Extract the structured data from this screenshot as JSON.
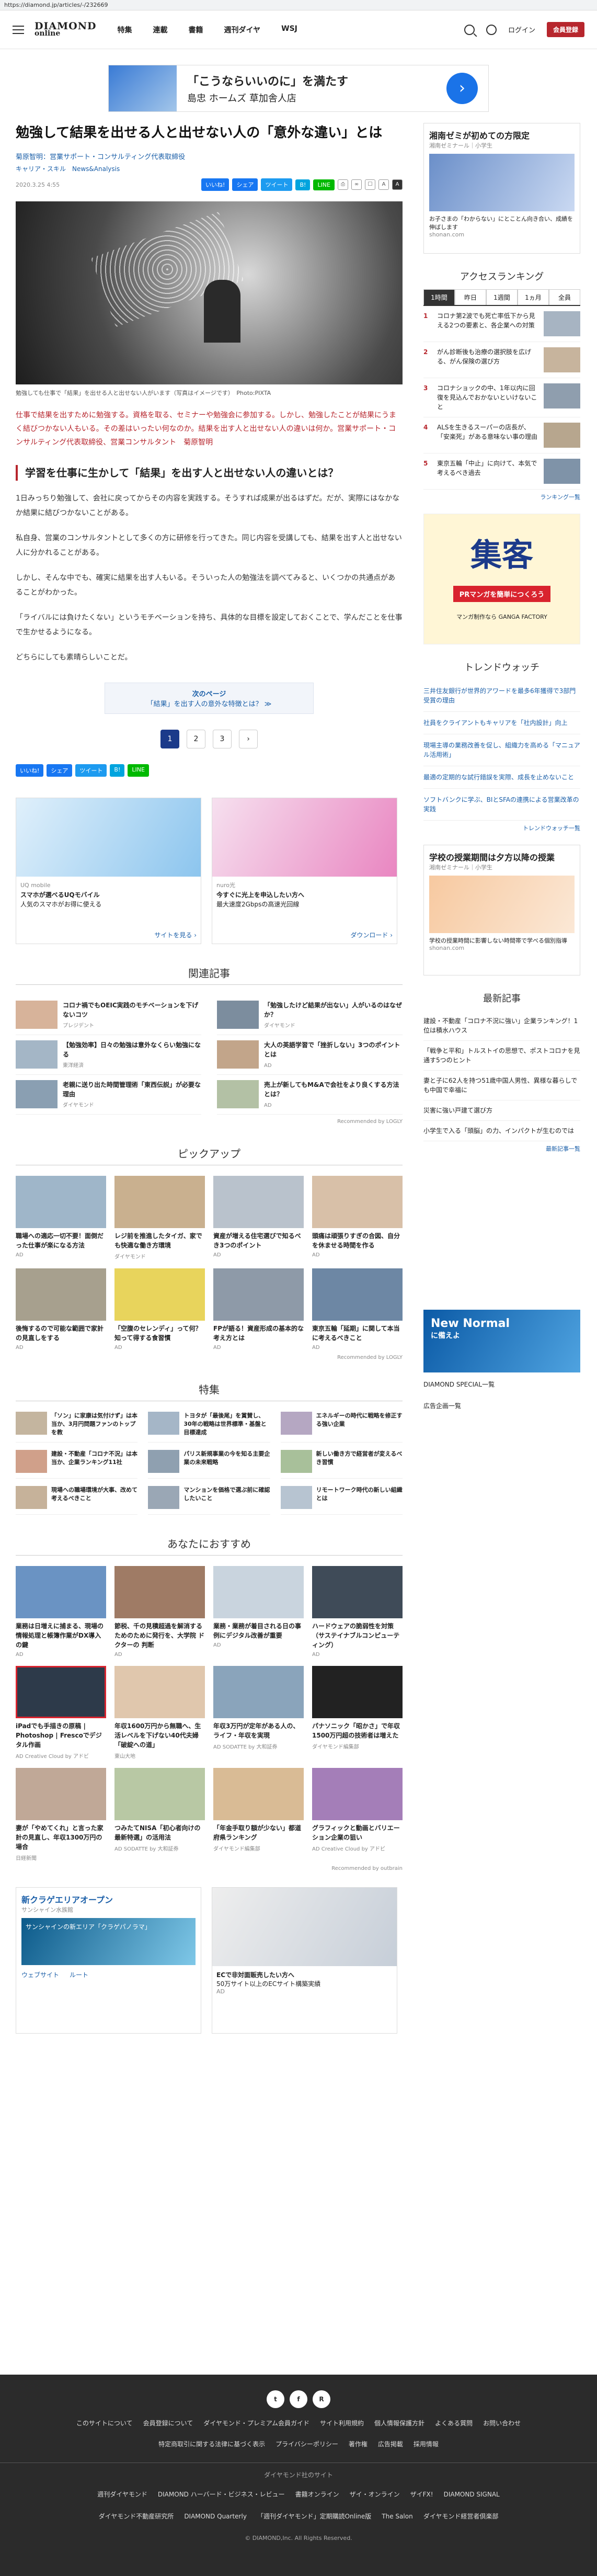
{
  "url": "https://diamond.jp/articles/-/232669",
  "header": {
    "logo_top": "DIAMOND",
    "logo_bottom": "online",
    "nav": [
      "特集",
      "連載",
      "書籍",
      "週刊ダイヤ",
      "WSJ"
    ],
    "login": "ログイン",
    "register": "会員登録"
  },
  "top_ad": {
    "line1": "「こうならいいのに」を満たす",
    "line2": "島忠 ホームズ 草加舎人店"
  },
  "article": {
    "title": "勉強して結果を出せる人と出せない人の「意外な違い」とは",
    "byline": "菊原智明：営業サポート・コンサルティング代表取締役",
    "tags": "キャリア・スキル　News&Analysis",
    "date": "2020.3.25 4:55",
    "caption": "勉強しても仕事で「結果」を出せる人と出せない人がいます（写真はイメージです）　Photo:PIXTA",
    "lead": "仕事で結果を出すために勉強する。資格を取る、セミナーや勉強会に参加する。しかし、勉強したことが結果にうまく結びつかない人もいる。その差はいったい何なのか。結果を出す人と出せない人の違いは何か。営業サポート・コンサルティング代表取締役、営業コンサルタント　菊原智明",
    "subheading": "学習を仕事に生かして「結果」を出す人と出せない人の違いとは？",
    "paras": [
      "1日みっちり勉強して、会社に戻ってからその内容を実践する。そうすれば成果が出るはずだ。だが、実際にはなかなか結果に結びつかないことがある。",
      "私自身、営業のコンサルタントとして多くの方に研修を行ってきた。同じ内容を受講しても、結果を出す人と出せない人に分かれることがある。",
      "しかし、そんな中でも、確実に結果を出す人もいる。そういった人の勉強法を調べてみると、いくつかの共通点があることがわかった。",
      "「ライバルには負けたくない」というモチベーションを持ち、具体的な目標を設定しておくことで、学んだことを仕事で生かせるようになる。",
      "どちらにしても素晴らしいことだ。"
    ],
    "next_label": "次のページ",
    "next_link": "「結果」を出す人の意外な特徴とは？ ≫",
    "pages": [
      "1",
      "2",
      "3",
      "›"
    ]
  },
  "share": {
    "like": "いいね!",
    "share": "シェア",
    "tweet": "ツイート",
    "hatena": "B!",
    "line": "LINE",
    "font_small": "A",
    "font_large": "A"
  },
  "ad_cards": [
    {
      "label": "UQ mobile",
      "title": "スマホが選べるUQモバイル",
      "desc": "人気のスマホがお得に使える",
      "cta": "サイトを見る ›"
    },
    {
      "label": "nuro光",
      "title": "今すぐに光上を申込したい方へ",
      "desc": "最大速度2Gbpsの高速光回線",
      "cta": "ダウンロード ›"
    }
  ],
  "related": {
    "title": "関連記事",
    "items": [
      {
        "title": "コロナ禍でもOEIC実践のモチベーションを下げないコツ",
        "source": "プレジデント"
      },
      {
        "title": "「勉強したけど結果が出ない」人がいるのはなぜか？",
        "source": "ダイヤモンド"
      },
      {
        "title": "【勉強効率】日々の勉強は意外なくらい勉強になる",
        "source": "東洋経済"
      },
      {
        "title": "大人の英語学習で「挫折しない」3つのポイントとは",
        "source": "AD"
      },
      {
        "title": "老親に送り出た時間管理術「東西伝説」が必要な理由",
        "source": "ダイヤモンド"
      },
      {
        "title": "売上が新してもM&Aで会社をより良くする方法とは？",
        "source": "AD"
      }
    ],
    "rec": "Recommended by LOGLY"
  },
  "pickup": {
    "title": "ピックアップ",
    "items": [
      {
        "title": "職場への適応一切不要！面倒だった仕事が楽になる方法",
        "src": "AD"
      },
      {
        "title": "レジ前を推進したタイガ、家でも快適な働き方環境",
        "src": "ダイヤモンド"
      },
      {
        "title": "資産が増える住宅選びで知るべき3つのポイント",
        "src": "AD"
      },
      {
        "title": "頭痛は頑張りすぎの合図、自分を休ませる時間を作る",
        "src": "AD"
      },
      {
        "title": "後悔するので可能な範囲で家計の見直しをする",
        "src": "AD"
      },
      {
        "title": "「空腹のセレンディ」って何？知って得する食習慣",
        "src": "AD"
      },
      {
        "title": "FPが語る！資産形成の基本的な考え方とは",
        "src": "AD"
      },
      {
        "title": "東京五輪「延期」に関して本当に考えるべきこと",
        "src": "AD"
      }
    ],
    "rec": "Recommended by LOGLY"
  },
  "features": {
    "title": "特集",
    "items": [
      {
        "title": "「ソン」に家康は気付けず」は本当か、3月円問題ファンのトップを教"
      },
      {
        "title": "トヨタが「最後尾」を賞賛し、30年の戦略は世界標準・基盤と目標達成"
      },
      {
        "title": "エネルギーの時代に戦略を修正する強い企業"
      },
      {
        "title": "建設・不動産「コロナ不況」は本当か、企業ランキング11社"
      },
      {
        "title": "パリス新規事業の今を知る主要企業の未来戦略"
      },
      {
        "title": "新しい働き方で経営者が変えるべき習慣"
      },
      {
        "title": "現場への職場環境が大事、改めて考えるべきこと"
      },
      {
        "title": "マンションを価格で選ぶ前に確認したいこと"
      },
      {
        "title": "リモートワーク時代の新しい組織とは"
      }
    ]
  },
  "osusume": {
    "title": "あなたにおすすめ",
    "items": [
      {
        "title": "業務は日増えに捕まる、現場の情報処理と帳簿作業がDX導入の鍵",
        "src": "AD"
      },
      {
        "title": "節税、千の見積超過を解消するためのために発行を、大学院 ドクターの 判断",
        "src": "AD"
      },
      {
        "title": "業務・業務が着目される日の事例にデジタル改善が重要",
        "src": "AD"
      },
      {
        "title": "ハードウェアの脆弱性を対策（サステイナブルコンピューティング）",
        "src": "AD"
      },
      {
        "title": "iPadでも手描きの原稿 | Photoshop | Frescoでデジタル作画",
        "src": "AD Creative Cloud by アドビ"
      },
      {
        "title": "年収1600万円から無職へ、生活レベルを下げない40代夫婦「破綻への道」",
        "src": "東山大地"
      },
      {
        "title": "年収3万円が定年がある人の、ライフ・年収を実現",
        "src": "AD SODATTE by 大和証券"
      },
      {
        "title": "パナソニック「昭かさ」で年収1500万円超の技術者は増えた",
        "src": "ダイヤモンド編集部"
      },
      {
        "title": "妻が「やめてくれ」と言った家計の見直し、年収1300万円の場合",
        "src": "日経新聞"
      },
      {
        "title": "つみたてNISA「初心者向けの最新特選」の活用法",
        "src": "AD SODATTE by 大和証券"
      },
      {
        "title": "「年金手取り額が少ない」都道府県ランキング",
        "src": "ダイヤモンド編集部"
      },
      {
        "title": "グラフィックと動画とバリエーション企業の狙い",
        "src": "AD Creative Cloud by アドビ"
      }
    ],
    "rec": "Recommended by outbrain"
  },
  "bottom_ads": [
    {
      "title": "新クラゲエリアオープン",
      "sub": "サンシャイン水族館",
      "desc": "サンシャインの新エリア「クラゲパノラマ」",
      "btn1": "ウェブサイト",
      "btn2": "ルート"
    },
    {
      "title": "ECで非対面販売したい方へ",
      "desc": "50万サイト以上のECサイト構築実績",
      "src": "AD"
    }
  ],
  "sidebar": {
    "ad1": {
      "title": "湘南ゼミが初めての方限定",
      "sub": "湘南ゼミナール｜小学生",
      "desc": "お子さまの「わからない」にとことん向き合い、成績を伸ばします",
      "src": "shonan.com"
    },
    "rank_title": "アクセスランキング",
    "rank_tabs": [
      "1時間",
      "昨日",
      "1週間",
      "1ヵ月",
      "全員"
    ],
    "rank": [
      {
        "n": "1",
        "t": "コロナ第2波でも死亡率低下から見える2つの要素と、各企業への対策"
      },
      {
        "n": "2",
        "t": "がん診断後も治療の選択肢を広げる、がん保険の選び方"
      },
      {
        "n": "3",
        "t": "コロナショックの中、1年以内に回復を見込んでおかないといけないこと"
      },
      {
        "n": "4",
        "t": "ALSを生きるスーパーの店長が、「安楽死」がある意味ない事の理由"
      },
      {
        "n": "5",
        "t": "東京五輪「中止」に向けて、本気で考えるべき過去"
      }
    ],
    "rank_more": "ランキング一覧",
    "manga": {
      "title": "集客",
      "sub": "PRマンガを簡単につくろう",
      "src": "マンガ制作なら GANGA FACTORY"
    },
    "watch_title": "トレンドウォッチ",
    "watch": [
      "三井住友銀行が世界的アワードを最多6年獲得で3部門受賞の理由",
      "社員をクライアントもキャリアを「社内設計」向上",
      "現場主導の業務改善を促し、組織力を高める「マニュアル活用術」",
      "最適の定期的な試行錯誤を実際、成長を止めないこと",
      "ソフトバンクに学ぶ、BIとSFAの連携による営業改革の実践"
    ],
    "watch_more": "トレンドウォッチ一覧",
    "ad2": {
      "title": "学校の授業期間は夕方以降の授業",
      "sub": "湘南ゼミナール｜小学生",
      "desc": "学校の授業時間に影響しない時間帯で学べる個別指導",
      "src": "shonan.com"
    },
    "news_title": "最新記事",
    "news": [
      "建設・不動産「コロナ不況に強い」企業ランキング！1位は積水ハウス",
      "「戦争と平和」トルストイの思想で、ポストコロナを見通す5つのヒント",
      "妻と子に62人を持つ51歳中国人男性、異様な暮らしでも中国で幸福に",
      "災害に強い戸建て選び方",
      "小学生で入る「頭脳」の力、インパクトが生むのでは"
    ],
    "news_more": "最新記事一覧",
    "newnormal": {
      "title": "New Normal",
      "sub": "に備えよ"
    },
    "special": "DIAMOND SPECIAL一覧",
    "ad_list": "広告企画一覧"
  },
  "footer": {
    "social": [
      "t",
      "f",
      "R"
    ],
    "links1": [
      "このサイトについて",
      "会員登録について",
      "ダイヤモンド・プレミアム会員ガイド",
      "サイト利用規約",
      "個人情報保護方針",
      "よくある質問",
      "お問い合わせ"
    ],
    "links2": [
      "特定商取引に関する法律に基づく表示",
      "プライバシーポリシー",
      "著作権",
      "広告掲載",
      "採用情報"
    ],
    "group": "ダイヤモンド社のサイト",
    "links3": [
      "週刊ダイヤモンド",
      "DIAMOND ハーバード・ビジネス・レビュー",
      "書籍オンライン",
      "ザイ・オンライン",
      "ザイFX!",
      "DIAMOND SIGNAL",
      "ダイヤモンド不動産研究所",
      "DIAMOND Quarterly",
      "「週刊ダイヤモンド」定期購読Online版",
      "The Salon",
      "ダイヤモンド経営者倶楽部"
    ],
    "copyright": "© DIAMOND,Inc. All Rights Reserved."
  }
}
